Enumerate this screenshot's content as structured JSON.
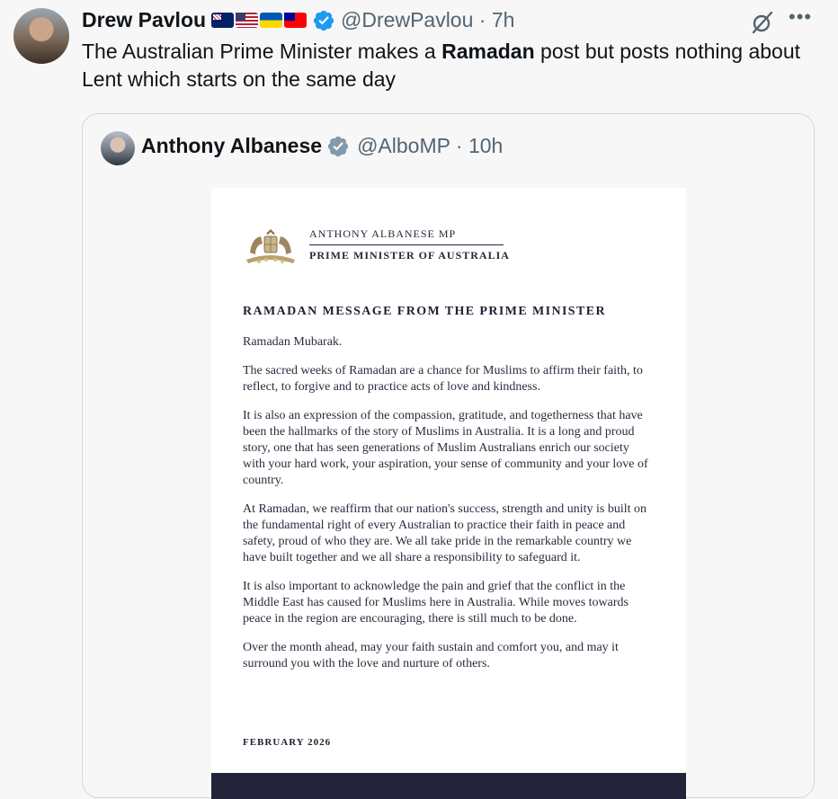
{
  "tweet": {
    "author_name": "Drew Pavlou",
    "flags": [
      "australia-flag-icon",
      "usa-flag-icon",
      "ukraine-flag-icon",
      "taiwan-flag-icon"
    ],
    "handle_time": "@DrewPavlou · 7h",
    "text_before": "The Australian Prime Minister makes a ",
    "text_bold": "Ramadan",
    "text_after": " post but posts nothing about Lent which starts on the same day"
  },
  "quoted": {
    "author_name": "Anthony Albanese",
    "handle_time": "@AlboMP · 10h",
    "letter": {
      "letterhead_name": "ANTHONY ALBANESE MP",
      "letterhead_title": "PRIME MINISTER OF AUSTRALIA",
      "heading": "RAMADAN MESSAGE FROM THE PRIME MINISTER",
      "greeting": "Ramadan Mubarak.",
      "p1": "The sacred weeks of Ramadan are a chance for Muslims to affirm their faith, to reflect, to forgive and to practice acts of love and kindness.",
      "p2": "It is also an expression of the compassion, gratitude, and togetherness that have been the hallmarks of the story of Muslims in Australia. It is a long and proud story, one that has seen generations of Muslim Australians enrich our society with your hard work, your aspiration, your sense of community and your love of country.",
      "p3": "At Ramadan, we reaffirm that our nation's success, strength and unity is built on the fundamental right of every Australian to practice their faith in peace and safety, proud of who they are. We all take pride in the remarkable country we have built together and we all share a responsibility to safeguard it.",
      "p4": "It is also important to acknowledge the pain and grief that the conflict in the Middle East has caused for Muslims here in Australia. While moves towards peace in the region are encouraging, there is still much to be done.",
      "p5": "Over the month ahead, may your faith sustain and comfort you, and may it surround you with the love and nurture of others.",
      "date": "FEBRUARY 2026"
    }
  },
  "icons": {
    "verified": "verified-badge-icon",
    "grok": "grok-icon",
    "more": "more-options-icon"
  },
  "colors": {
    "verified_blue": "#1d9bf0",
    "verified_gray": "#829aab",
    "secondary_text": "#536471"
  }
}
